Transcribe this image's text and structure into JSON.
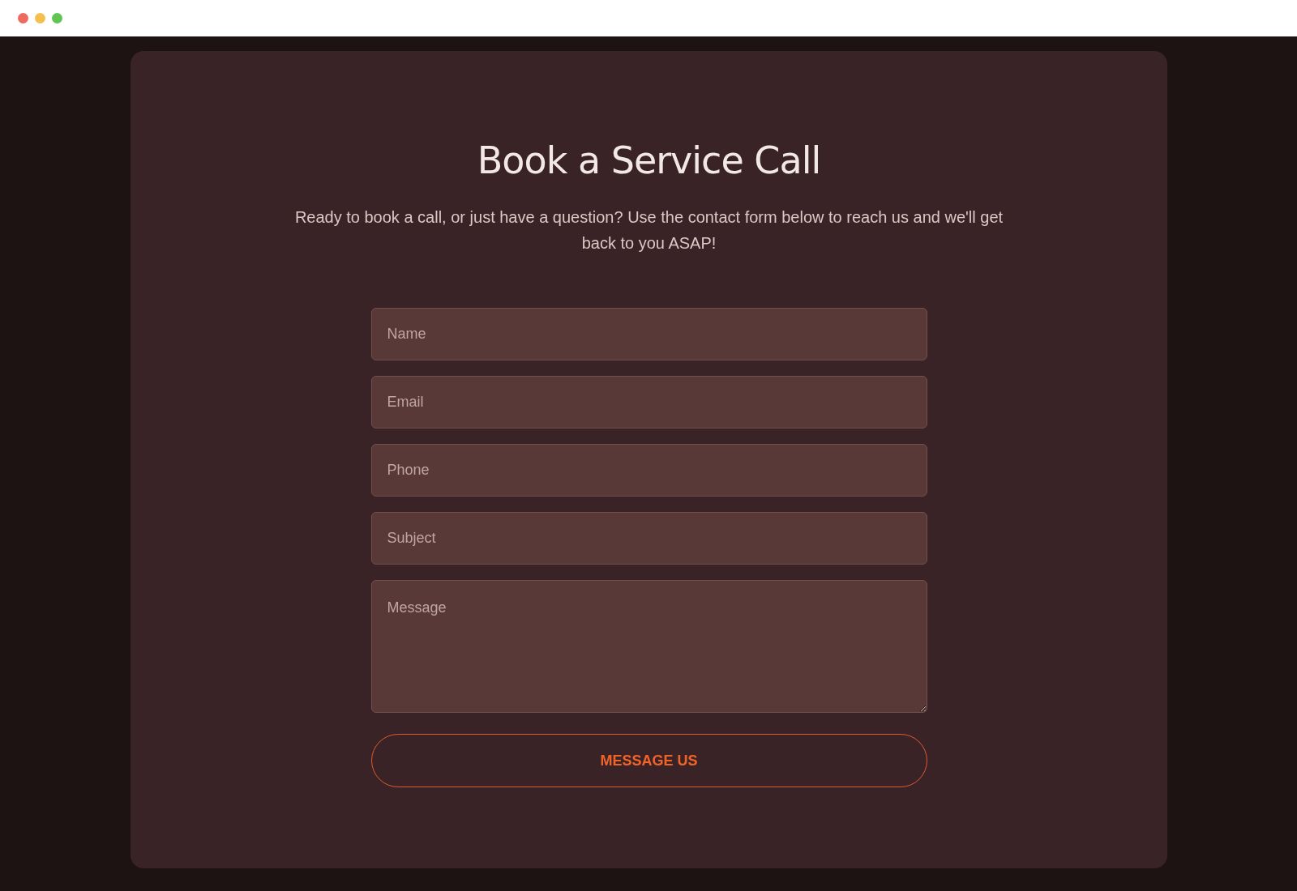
{
  "title": "Book a Service Call",
  "intro": "Ready to book a call, or just have a question? Use the contact form below to reach us and we'll get back to you ASAP!",
  "fields": [
    {
      "kind": "input",
      "placeholder": "Name"
    },
    {
      "kind": "input",
      "placeholder": "Email"
    },
    {
      "kind": "input",
      "placeholder": "Phone"
    },
    {
      "kind": "input",
      "placeholder": "Subject"
    },
    {
      "kind": "textarea",
      "placeholder": "Message"
    }
  ],
  "submit": {
    "label": "MESSAGE US"
  }
}
